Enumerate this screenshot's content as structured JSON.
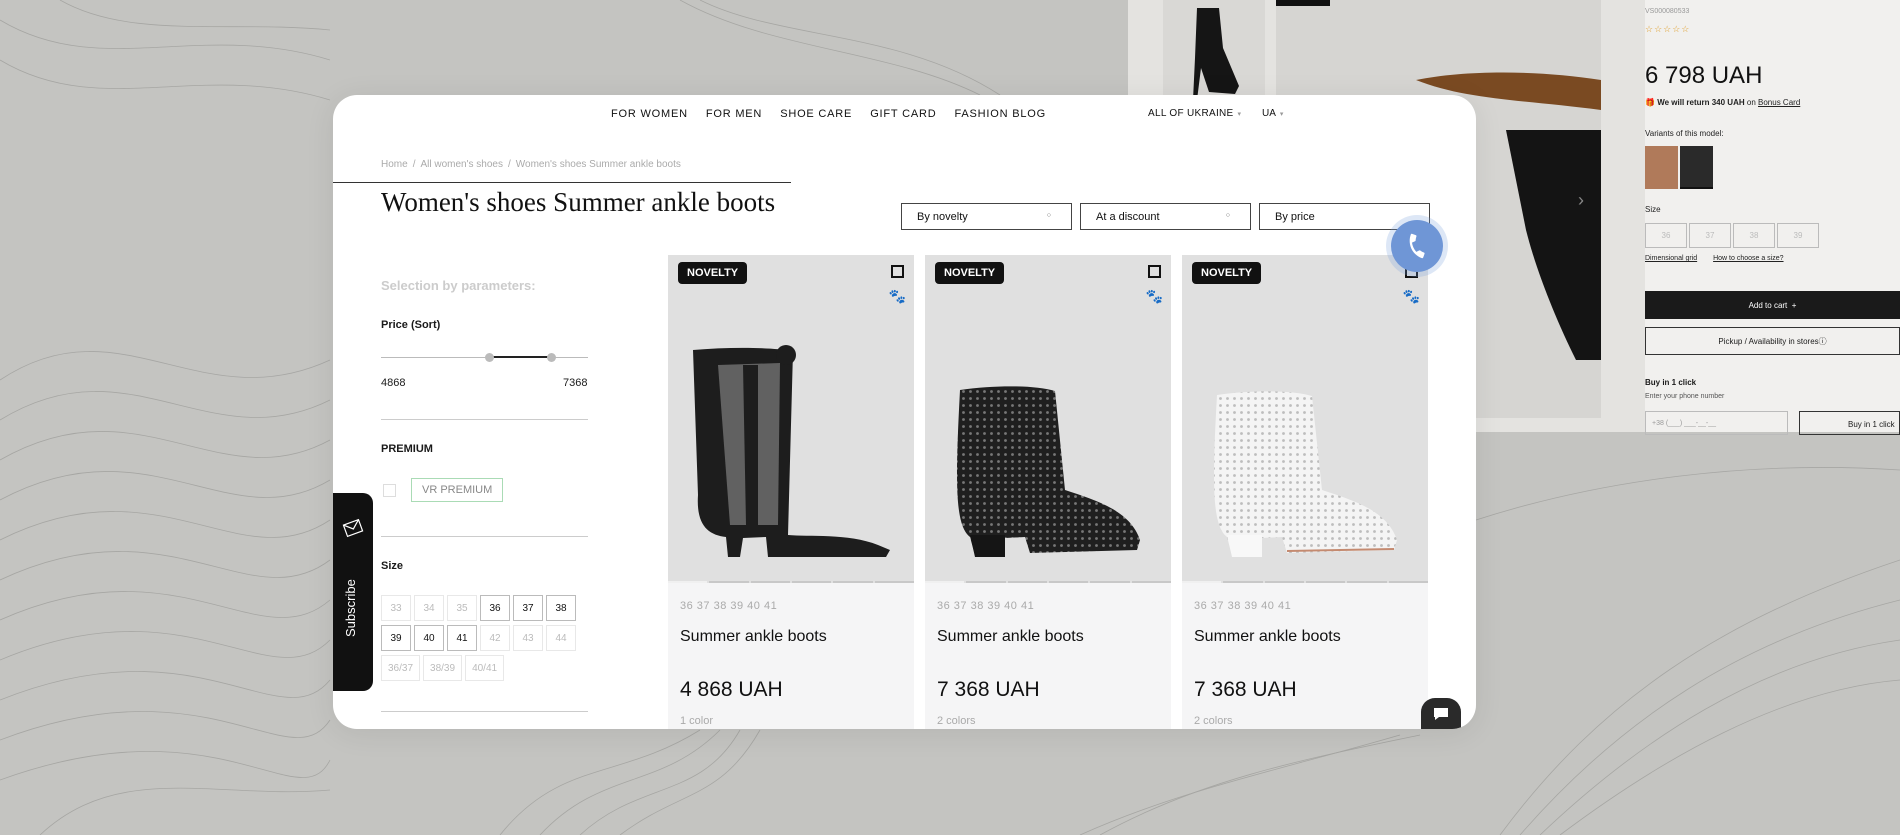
{
  "background_page": {
    "sku": "VS000080533",
    "stars": "☆☆☆☆☆",
    "price": "6 798 UAH",
    "bonus_text": "We will return 340 UAH",
    "bonus_on": "on",
    "bonus_link": "Bonus Card",
    "variants_label": "Variants of this model:",
    "size_label": "Size",
    "sizes": [
      "36",
      "37",
      "38",
      "39"
    ],
    "dimensional_grid": "Dimensional grid",
    "how_to_choose": "How to choose a size?",
    "add_to_cart": "Add to cart",
    "pickup": "Pickup / Availability in stores",
    "buy_one_click_title": "Buy in 1 click",
    "enter_phone": "Enter your phone number",
    "phone_placeholder": "+38 (___) ___-__-__",
    "buy_one_click_button": "Buy in 1 click"
  },
  "nav": {
    "items": [
      "FOR WOMEN",
      "FOR MEN",
      "SHOE CARE",
      "GIFT CARD",
      "FASHION BLOG"
    ],
    "region": "ALL OF UKRAINE",
    "lang": "UA"
  },
  "breadcrumbs": [
    "Home",
    "All women's shoes",
    "Women's shoes Summer ankle boots"
  ],
  "page_title": "Women's shoes Summer ankle boots",
  "sort": {
    "novelty": "By novelty",
    "discount": "At a discount",
    "price": "By price"
  },
  "filters": {
    "title": "Selection by parameters:",
    "price_title": "Price (Sort)",
    "price_min": "4868",
    "price_max": "7368",
    "premium_title": "PREMIUM",
    "premium_tag": "VR PREMIUM",
    "size_title": "Size",
    "sizes": [
      {
        "label": "33",
        "available": false
      },
      {
        "label": "34",
        "available": false
      },
      {
        "label": "35",
        "available": false
      },
      {
        "label": "36",
        "available": true
      },
      {
        "label": "37",
        "available": true
      },
      {
        "label": "38",
        "available": true
      },
      {
        "label": "39",
        "available": true
      },
      {
        "label": "40",
        "available": true
      },
      {
        "label": "41",
        "available": true
      },
      {
        "label": "42",
        "available": false
      },
      {
        "label": "43",
        "available": false
      },
      {
        "label": "44",
        "available": false
      },
      {
        "label": "36/37",
        "available": false
      },
      {
        "label": "38/39",
        "available": false
      },
      {
        "label": "40/41",
        "available": false
      }
    ]
  },
  "subscribe_label": "Subscribe",
  "products": [
    {
      "badge": "NOVELTY",
      "sizes": "36  37  38  39  40  41",
      "name": "Summer ankle boots",
      "price": "4 868 UAH",
      "colors": "1 color",
      "color": "#1d1d1d"
    },
    {
      "badge": "NOVELTY",
      "sizes": "36  37  38  39  40  41",
      "name": "Summer ankle boots",
      "price": "7 368 UAH",
      "colors": "2 colors",
      "color": "#1f1f1f"
    },
    {
      "badge": "NOVELTY",
      "sizes": "36  37  38  39  40  41",
      "name": "Summer ankle boots",
      "price": "7 368 UAH",
      "colors": "2 colors",
      "color": "#f2f2f2"
    }
  ],
  "colors": {
    "accent_call": "#6f96d6",
    "badge": "#111111",
    "background": "#c4c4c1"
  }
}
